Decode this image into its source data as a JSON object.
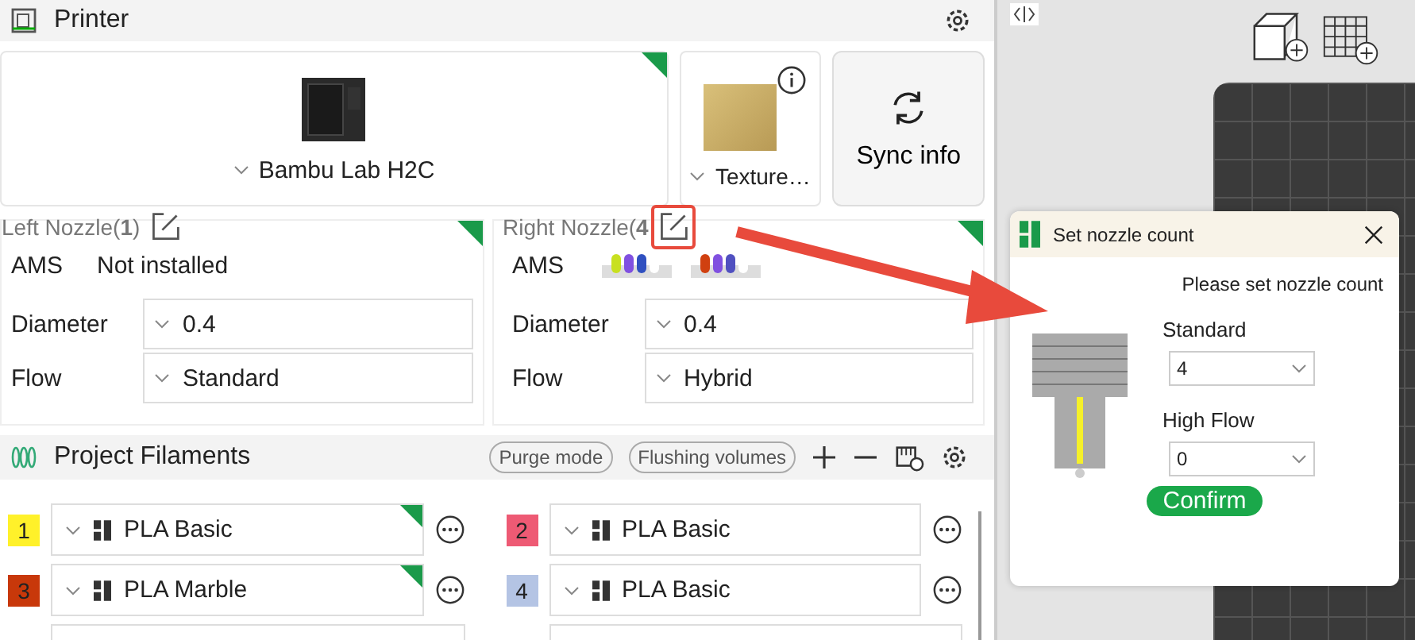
{
  "printer_panel": {
    "title": "Printer"
  },
  "printer": {
    "name": "Bambu Lab H2C",
    "selected": true
  },
  "plate": {
    "name": "Texture…"
  },
  "sync_button": {
    "label": "Sync info"
  },
  "nozzles": [
    {
      "title": "Left Nozzle(**1**)",
      "highlighted": false,
      "selected": true,
      "ams_label": "AMS",
      "ams_status": "Not installed",
      "diameter_label": "Diameter",
      "diameter": "0.4",
      "flow_label": "Flow",
      "flow": "Standard"
    },
    {
      "title": "Right Nozzle(**4**",
      "highlighted": true,
      "selected": true,
      "ams_label": "AMS",
      "ams_units": [
        {
          "spools": [
            {
              "color": "#c8e020"
            },
            {
              "color": "#8050e0"
            },
            {
              "color": "#3050c0"
            },
            {
              "color": "#ffffff"
            }
          ]
        },
        {
          "spools": [
            {
              "color": "#d04010"
            },
            {
              "color": "#8050e0"
            },
            {
              "color": "#5050c0"
            },
            {
              "color": "#ffffff"
            }
          ]
        }
      ],
      "diameter_label": "Diameter",
      "diameter": "0.4",
      "flow_label": "Flow",
      "flow": "Hybrid"
    }
  ],
  "filaments_panel": {
    "title": "Project Filaments",
    "buttons": [
      "Purge mode",
      "Flushing volumes"
    ]
  },
  "filaments": [
    {
      "slot": "1",
      "color": "#fff12a",
      "name": "PLA Basic",
      "selected": true
    },
    {
      "slot": "2",
      "color": "#ee5a74",
      "name": "PLA Basic",
      "selected": false
    },
    {
      "slot": "3",
      "color": "#c8380a",
      "name": "PLA Marble",
      "selected": true
    },
    {
      "slot": "4",
      "color": "#b4c4e4",
      "name": "PLA Basic",
      "selected": false
    }
  ],
  "dialog": {
    "title": "Set nozzle count",
    "prompt": "Please set nozzle count",
    "fields": [
      {
        "label": "Standard",
        "value": "4"
      },
      {
        "label": "High Flow",
        "value": "0"
      }
    ],
    "confirm": "Confirm"
  }
}
